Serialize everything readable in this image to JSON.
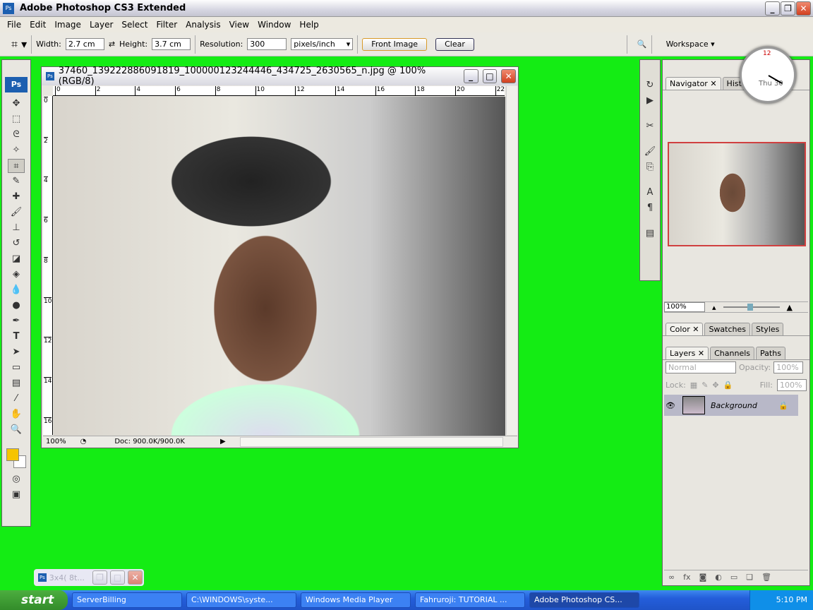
{
  "app": {
    "title": "Adobe Photoshop CS3 Extended"
  },
  "menu": [
    "File",
    "Edit",
    "Image",
    "Layer",
    "Select",
    "Filter",
    "Analysis",
    "View",
    "Window",
    "Help"
  ],
  "options": {
    "width_label": "Width:",
    "width": "2.7 cm",
    "height_label": "Height:",
    "height": "3.7 cm",
    "resolution_label": "Resolution:",
    "resolution": "300",
    "units": "pixels/inch",
    "front_image": "Front Image",
    "clear": "Clear",
    "workspace": "Workspace"
  },
  "document": {
    "title": "37460_139222886091819_100000123244446_434725_2630565_n.jpg @ 100% (RGB/8)",
    "zoom": "100%",
    "doc_info": "Doc: 900.0K/900.0K",
    "ruler_top": [
      "0",
      "2",
      "4",
      "6",
      "8",
      "10",
      "12",
      "14",
      "16",
      "18",
      "20",
      "22"
    ],
    "ruler_left": [
      "0",
      "2",
      "4",
      "6",
      "8",
      "10",
      "12",
      "14",
      "16"
    ]
  },
  "navigator": {
    "tabs": [
      "Navigator",
      "Histogram"
    ],
    "zoom": "100%"
  },
  "color_panel": {
    "tabs": [
      "Color",
      "Swatches",
      "Styles"
    ]
  },
  "layers_panel": {
    "tabs": [
      "Layers",
      "Channels",
      "Paths"
    ],
    "blend": "Normal",
    "opacity_label": "Opacity:",
    "opacity": "100%",
    "lock_label": "Lock:",
    "fill_label": "Fill:",
    "fill": "100%",
    "layer": "Background"
  },
  "clock": {
    "day": "Thu 30"
  },
  "minimized": {
    "title": "3x4( 8t..."
  },
  "taskbar": {
    "start": "start",
    "tasks": [
      "ServerBilling",
      "C:\\WINDOWS\\syste...",
      "Windows Media Player",
      "Fahruroji: TUTORIAL ...",
      "Adobe Photoshop CS..."
    ],
    "time": "5:10 PM"
  },
  "colors": {
    "background": "#14ec14",
    "foreground_swatch": "#f5c400"
  }
}
